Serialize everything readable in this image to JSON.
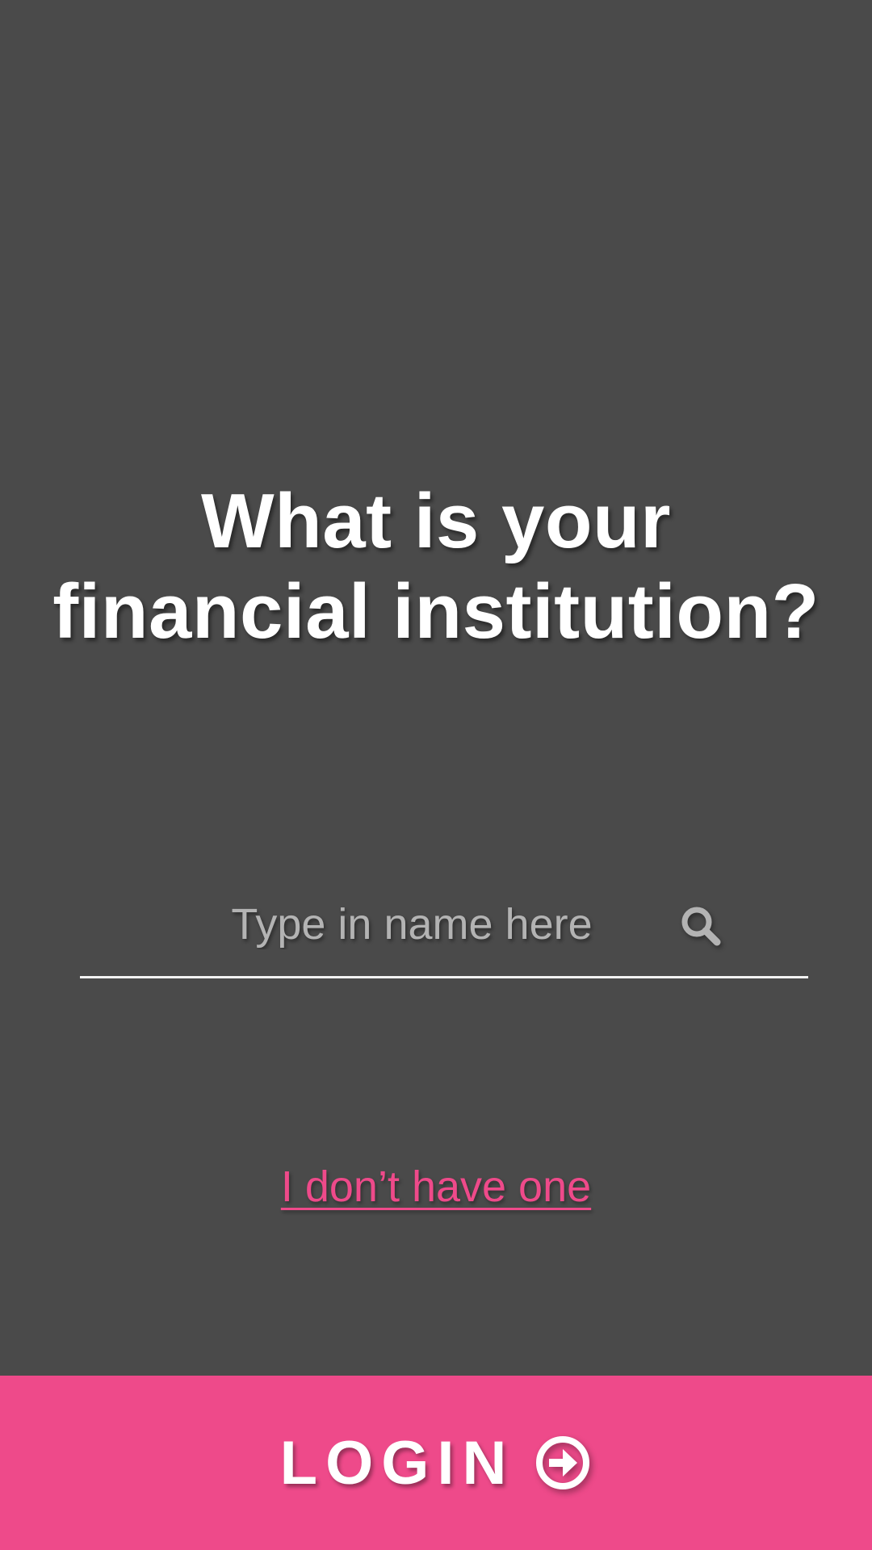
{
  "screen": {
    "title_line1": "What is your",
    "title_line2": "financial institution?"
  },
  "search": {
    "placeholder": "Type in name here",
    "value": "",
    "icon": "search-icon"
  },
  "links": {
    "no_account": "I don’t have one"
  },
  "login": {
    "label": "LOGIN",
    "icon": "arrow-circle-right-icon"
  },
  "colors": {
    "background": "#4a4a4a",
    "accent": "#ee4a8a",
    "text": "#ffffff",
    "placeholder": "#b3b3b3"
  }
}
